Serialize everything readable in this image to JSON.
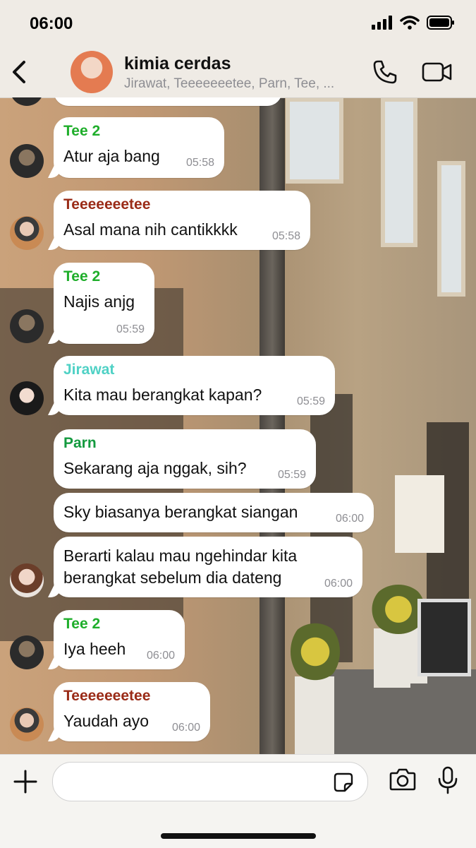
{
  "status": {
    "time": "06:00"
  },
  "header": {
    "title": "kimia cerdas",
    "subtitle": "Jirawat, Teeeeeeetee, Parn, Tee, ..."
  },
  "colors": {
    "tee2": "#1fae2b",
    "teeeeeeetee": "#9a2b17",
    "jirawat": "#4fd1c5",
    "parn": "#149a3f"
  },
  "messages": [
    {
      "sender": "Tee 2",
      "text": "Atur aja bang",
      "time": "05:58"
    },
    {
      "sender": "Teeeeeeetee",
      "text": "Asal mana nih cantikkkk",
      "time": "05:58"
    },
    {
      "sender": "Tee 2",
      "text": "Najis anjg",
      "time": "05:59"
    },
    {
      "sender": "Jirawat",
      "text": "Kita mau berangkat kapan?",
      "time": "05:59"
    },
    {
      "sender": "Parn",
      "text": "Sekarang aja nggak, sih?",
      "time": "05:59"
    },
    {
      "sender": "",
      "text": "Sky biasanya berangkat siangan",
      "time": "06:00"
    },
    {
      "sender": "",
      "text": "Berarti kalau mau ngehindar kita",
      "text2": "berangkat sebelum dia dateng",
      "time": "06:00"
    },
    {
      "sender": "Tee 2",
      "text": "Iya heeh",
      "time": "06:00"
    },
    {
      "sender": "Teeeeeeetee",
      "text": "Yaudah ayo",
      "time": "06:00"
    }
  ],
  "composer": {
    "placeholder": ""
  }
}
